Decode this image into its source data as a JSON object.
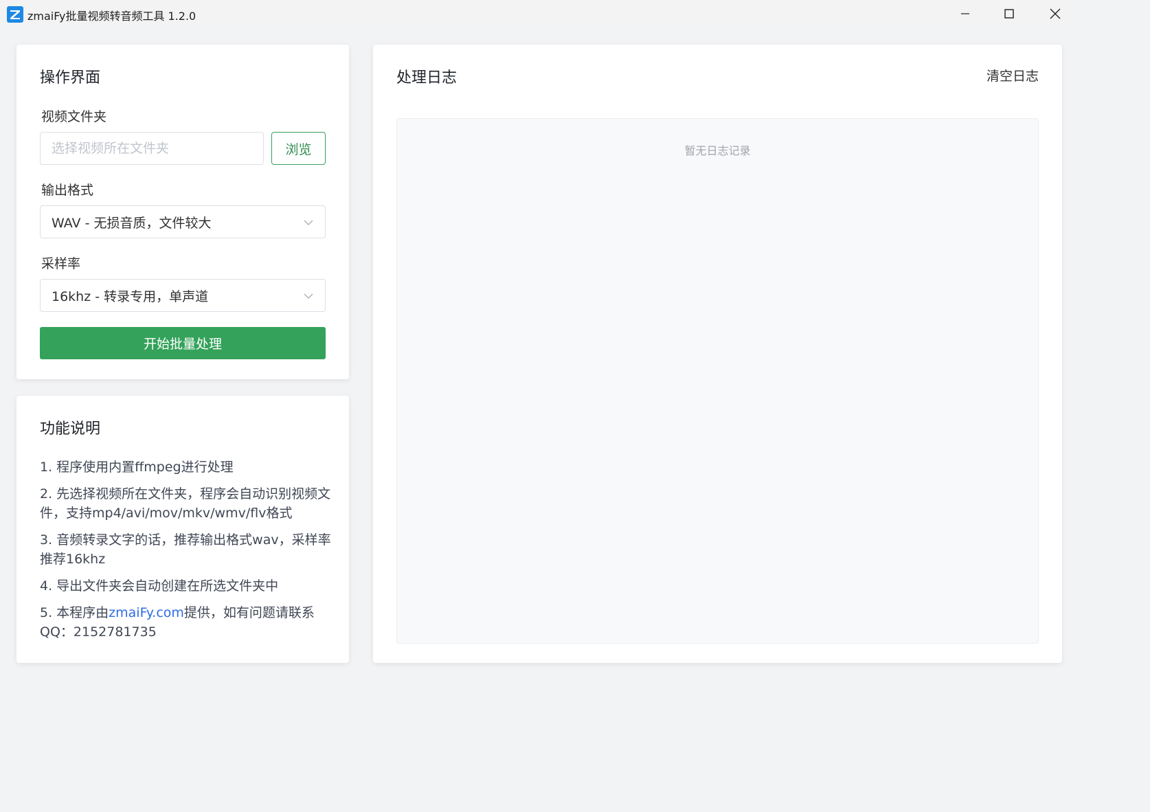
{
  "window": {
    "title": "zmaiFy批量视频转音频工具 1.2.0",
    "icon": "app-logo-icon",
    "controls": [
      "minimize-icon",
      "maximize-icon",
      "close-icon"
    ]
  },
  "ops": {
    "title": "操作界面",
    "folder_label": "视频文件夹",
    "folder_value": "",
    "folder_placeholder": "选择视频所在文件夹",
    "browse_label": "浏览",
    "format_label": "输出格式",
    "format_value": "WAV - 无损音质，文件较大",
    "rate_label": "采样率",
    "rate_value": "16khz - 转录专用，单声道",
    "start_label": "开始批量处理"
  },
  "help": {
    "title": "功能说明",
    "items": [
      "1. 程序使用内置ffmpeg进行处理",
      "2. 先选择视频所在文件夹，程序会自动识别视频文件，支持mp4/avi/mov/mkv/wmv/flv格式",
      "3. 音频转录文字的话，推荐输出格式wav，采样率推荐16khz",
      "4. 导出文件夹会自动创建在所选文件夹中"
    ],
    "item5_prefix": "5. 本程序由",
    "item5_link": "zmaiFy.com",
    "item5_suffix": "提供，如有问题请联系QQ：2152781735"
  },
  "log": {
    "title": "处理日志",
    "clear_label": "清空日志",
    "empty_text": "暂无日志记录"
  },
  "colors": {
    "primary": "#34a25a",
    "link": "#2f6ce5",
    "background": "#f2f3f5"
  }
}
